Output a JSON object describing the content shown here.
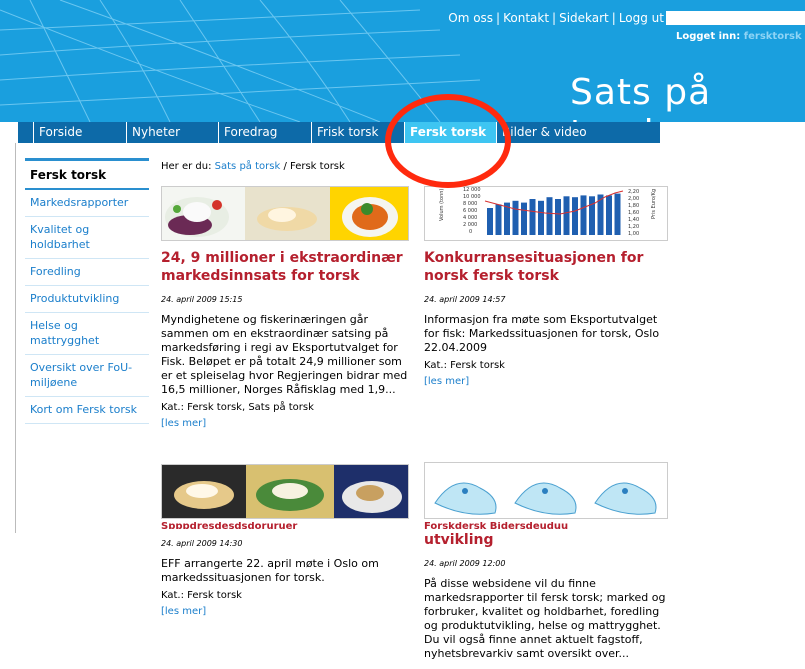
{
  "header": {
    "top_links": [
      "Om oss",
      "Kontakt",
      "Sidekart",
      "Logg ut"
    ],
    "logged_in_label": "Logget inn:",
    "logged_in_user": "fersktorsk",
    "site_title": "Sats på torsk",
    "search": {
      "value": "",
      "placeholder": ""
    }
  },
  "nav": {
    "items": [
      {
        "label": "Forside"
      },
      {
        "label": "Nyheter"
      },
      {
        "label": "Foredrag"
      },
      {
        "label": "Frisk torsk"
      },
      {
        "label": "Fersk torsk"
      },
      {
        "label": "Bilder & video"
      }
    ],
    "active": "Fersk torsk"
  },
  "sidebar": {
    "heading": "Fersk torsk",
    "items": [
      {
        "label": "Markedsrapporter"
      },
      {
        "label": "Kvalitet og holdbarhet"
      },
      {
        "label": "Foredling"
      },
      {
        "label": "Produktutvikling"
      },
      {
        "label": "Helse og mattrygghet"
      },
      {
        "label": "Oversikt over FoU-miljøene"
      },
      {
        "label": "Kort om Fersk torsk"
      }
    ]
  },
  "breadcrumb": {
    "prefix": "Her er du:",
    "link": "Sats på torsk",
    "separator": "/",
    "current": "Fersk torsk"
  },
  "articles": [
    {
      "title": "24, 9 millioner i ekstraordinær markedsinnsats for torsk",
      "date": "24. april 2009 15:15",
      "body": "Myndighetene og fiskerinæringen går sammen om en ekstraordinær satsing på markedsføring i regi av Eksportutvalget for Fisk. Beløpet er på totalt 24,9 millioner som er et spleiselag hvor Regjeringen bidrar med 16,5 millioner, Norges Råfisklag med 1,9...",
      "category": "Kat.: Fersk torsk, Sats på torsk",
      "more": "[les mer]"
    },
    {
      "title": "Konkurransesituasjonen for norsk fersk torsk",
      "date": "24. april 2009 14:57",
      "body": "Informasjon fra møte som Eksportutvalget for fisk: Markedssituasjonen for torsk, Oslo 22.04.2009",
      "category": "Kat.: Fersk torsk",
      "more": "[les mer]",
      "chart_labels": {
        "left_ticks": [
          "12 000",
          "10 000",
          "8 000",
          "6 000",
          "4 000",
          "2 000",
          "0"
        ],
        "right_ticks": [
          "2,20",
          "2,00",
          "1,80",
          "1,60",
          "1,40",
          "1,20",
          "1,00"
        ],
        "left_axis": "Volum (tonn)",
        "right_axis": "Pris Euro/Kg"
      }
    },
    {
      "title_cut": "Spppdresdesdsdoruruer",
      "date": "24. april 2009 14:30",
      "body": "EFF arrangerte 22. april møte i Oslo om markedssituasjonen for torsk.",
      "category": "Kat.: Fersk torsk",
      "more": "[les mer]"
    },
    {
      "title_cut": "Forskdersk Bidersdeuduu",
      "title": "utvikling",
      "date": "24. april 2009 12:00",
      "body": "På disse websidene vil du finne markedsrapporter til fersk torsk; marked og forbruker, kvalitet og holdbarhet, foredling og produktutvikling, helse og mattrygghet. Du vil også finne annet aktuelt fagstoff, nyhetsbrevarkiv samt oversikt over..."
    }
  ],
  "colors": {
    "banner": "#1a9fde",
    "nav": "#0d6aa8",
    "nav_active": "#3ec5f2",
    "title_red": "#b5202e",
    "link_blue": "#1a7ecb",
    "highlight": "#ff2a0e"
  }
}
